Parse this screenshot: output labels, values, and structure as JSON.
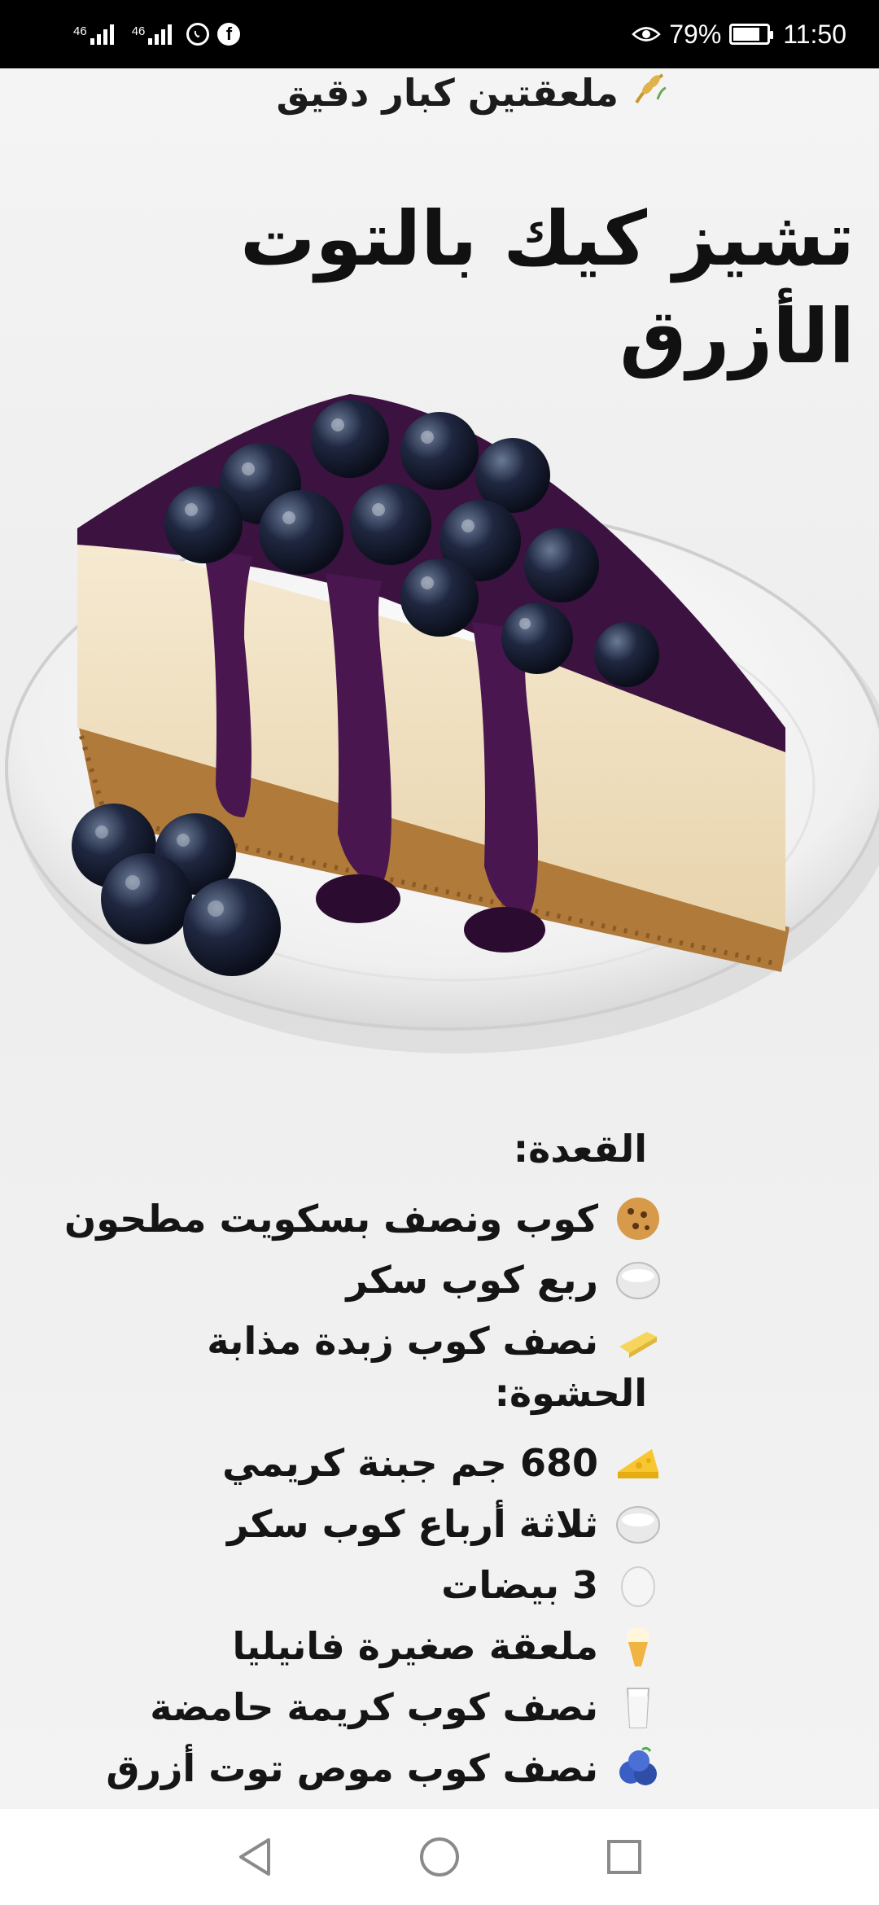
{
  "status_bar": {
    "sim1_label": "46",
    "sim2_label": "46",
    "battery_percent": "79%",
    "battery_level": 0.79,
    "time": "11:50",
    "icons": [
      "signal-icon",
      "signal-icon",
      "whatsapp-icon",
      "facebook-icon",
      "eye-comfort-icon",
      "battery-icon"
    ]
  },
  "recipe": {
    "top_line": "ملعقتين كبار دقيق",
    "title": "تشيز كيك بالتوت الأزرق",
    "base_heading": "القعدة:",
    "base_items": [
      {
        "icon": "cookie-icon",
        "text": "كوب ونصف بسكويت مطحون"
      },
      {
        "icon": "sugar-bowl-icon",
        "text": "ربع كوب سكر"
      },
      {
        "icon": "butter-icon",
        "text": "نصف كوب زبدة مذابة"
      }
    ],
    "filling_heading": "الحشوة:",
    "filling_items": [
      {
        "icon": "cheese-icon",
        "text": "680 جم جبنة كريمي"
      },
      {
        "icon": "sugar-bowl-icon",
        "text": "ثلاثة أرباع كوب سكر"
      },
      {
        "icon": "egg-icon",
        "text": "3 بيضات"
      },
      {
        "icon": "vanilla-icon",
        "text": "ملعقة صغيرة فانيليا"
      },
      {
        "icon": "milk-glass-icon",
        "text": "نصف كوب كريمة حامضة"
      },
      {
        "icon": "blueberry-icon",
        "text": "نصف كوب موص توت أزرق"
      }
    ]
  },
  "nav_bar": {
    "buttons": [
      "back-icon",
      "home-icon",
      "recents-icon"
    ]
  }
}
